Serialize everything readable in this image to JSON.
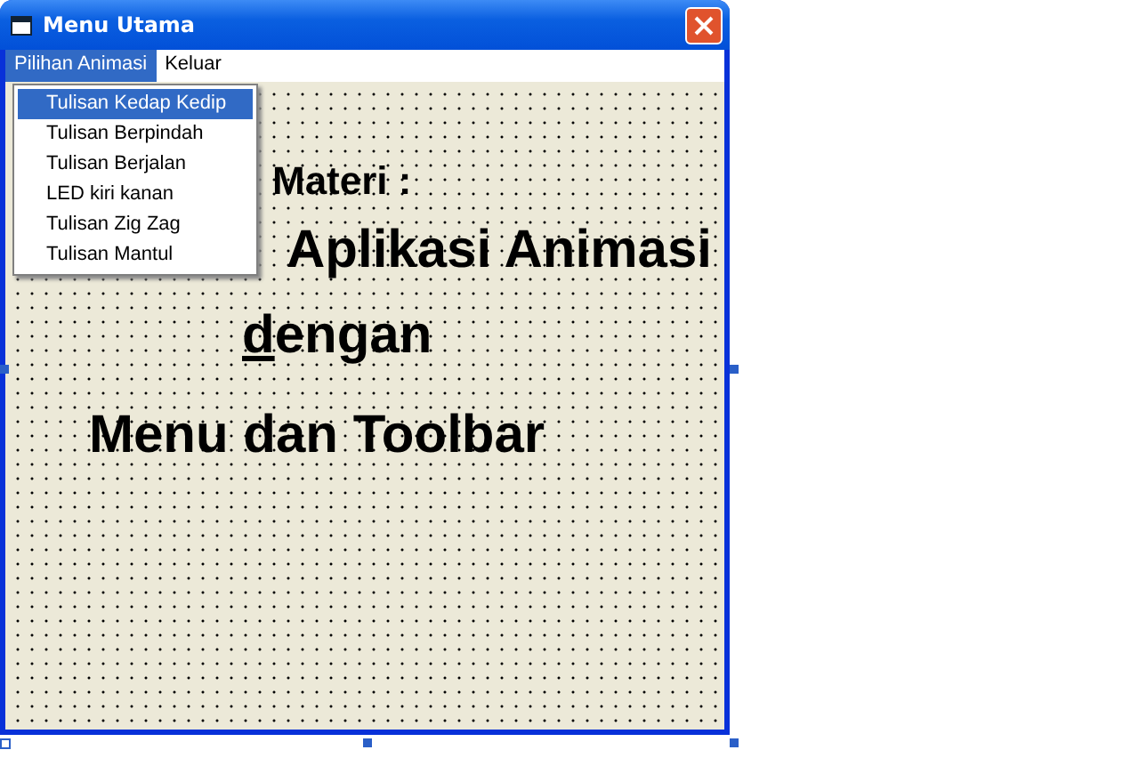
{
  "window": {
    "title": "Menu Utama"
  },
  "menu_bar": [
    {
      "label": "Pilihan Animasi",
      "selected": true
    },
    {
      "label": "Keluar",
      "selected": false
    }
  ],
  "dropdown": [
    {
      "label": "Tulisan Kedap Kedip",
      "selected": true
    },
    {
      "label": "Tulisan Berpindah",
      "selected": false
    },
    {
      "label": "Tulisan Berjalan",
      "selected": false
    },
    {
      "label": "LED kiri kanan",
      "selected": false
    },
    {
      "label": "Tulisan Zig Zag",
      "selected": false
    },
    {
      "label": "Tulisan Mantul",
      "selected": false
    }
  ],
  "labels": [
    {
      "text": "Materi :",
      "underline_first": false
    },
    {
      "text": "Aplikasi Animasi",
      "underline_first": false
    },
    {
      "text": "dengan",
      "underline_first": true
    },
    {
      "text": "Menu dan Toolbar",
      "underline_first": false
    }
  ]
}
